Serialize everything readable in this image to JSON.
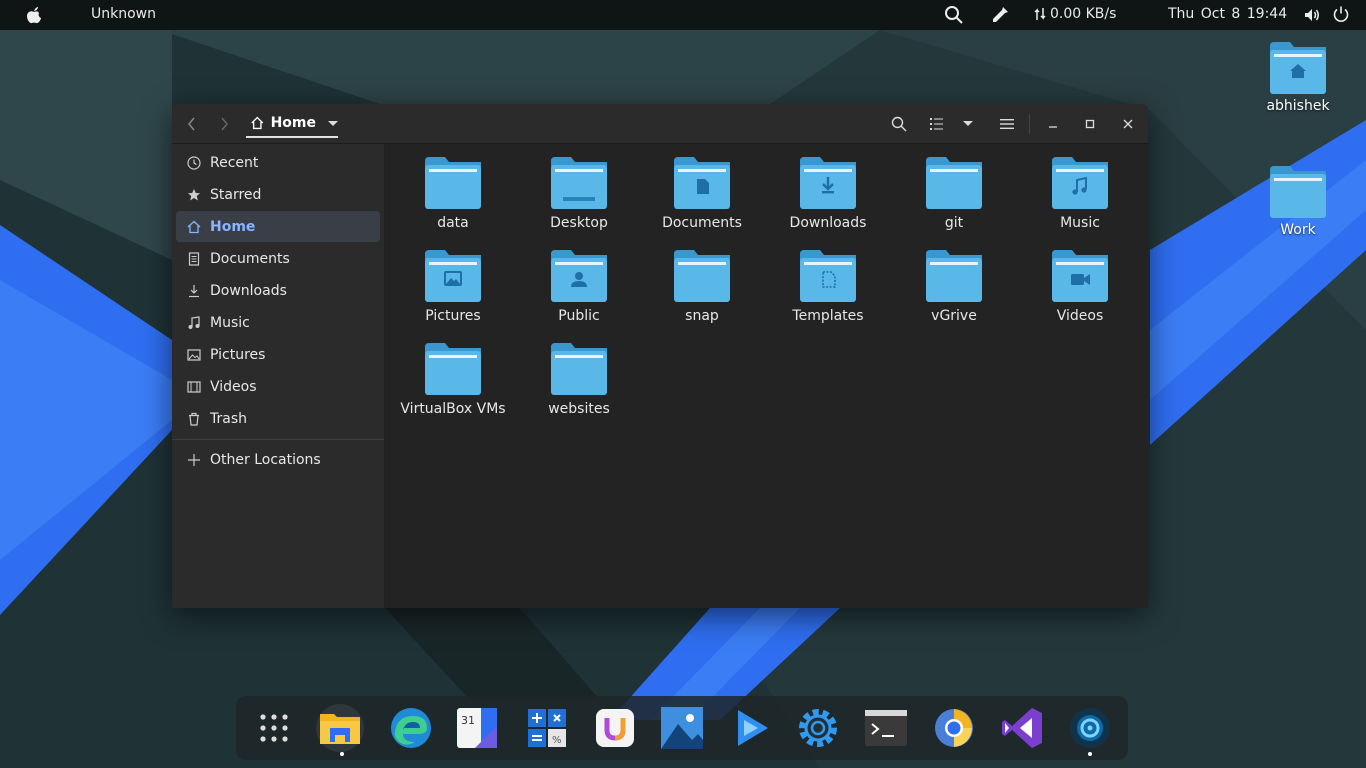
{
  "topbar": {
    "app_name": "Unknown",
    "network": "0.00 KB/s",
    "clock": "Thu Oct 8  19:44",
    "icons": [
      "apple-icon",
      "search-icon",
      "color-picker-icon",
      "network-arrows-icon",
      "volume-icon",
      "power-icon"
    ]
  },
  "desktop": {
    "icons": [
      {
        "label": "abhishek",
        "icon": "home-folder-icon"
      },
      {
        "label": "Work",
        "icon": "folder-icon"
      }
    ]
  },
  "window": {
    "path_label": "Home",
    "sidebar": [
      {
        "label": "Recent",
        "icon": "clock-icon"
      },
      {
        "label": "Starred",
        "icon": "star-icon"
      },
      {
        "label": "Home",
        "icon": "home-icon",
        "active": true
      },
      {
        "label": "Documents",
        "icon": "document-icon"
      },
      {
        "label": "Downloads",
        "icon": "download-icon"
      },
      {
        "label": "Music",
        "icon": "music-icon"
      },
      {
        "label": "Pictures",
        "icon": "picture-icon"
      },
      {
        "label": "Videos",
        "icon": "video-icon"
      },
      {
        "label": "Trash",
        "icon": "trash-icon"
      }
    ],
    "other_locations": "Other Locations",
    "folders": [
      {
        "label": "data",
        "emblem": "none"
      },
      {
        "label": "Desktop",
        "emblem": "desktop"
      },
      {
        "label": "Documents",
        "emblem": "document"
      },
      {
        "label": "Downloads",
        "emblem": "download"
      },
      {
        "label": "git",
        "emblem": "none"
      },
      {
        "label": "Music",
        "emblem": "music"
      },
      {
        "label": "Pictures",
        "emblem": "picture"
      },
      {
        "label": "Public",
        "emblem": "person"
      },
      {
        "label": "snap",
        "emblem": "none"
      },
      {
        "label": "Templates",
        "emblem": "template"
      },
      {
        "label": "vGrive",
        "emblem": "none"
      },
      {
        "label": "Videos",
        "emblem": "video"
      },
      {
        "label": "VirtualBox VMs",
        "emblem": "none"
      },
      {
        "label": "websites",
        "emblem": "none"
      }
    ]
  },
  "dock": {
    "apps": [
      "app-grid-icon",
      "files-app-icon",
      "edge-browser-icon",
      "calendar-app-icon",
      "calculator-app-icon",
      "ulauncher-app-icon",
      "image-viewer-app-icon",
      "video-player-app-icon",
      "settings-app-icon",
      "terminal-app-icon",
      "chromium-app-icon",
      "visual-studio-app-icon",
      "dock-app-icon"
    ],
    "calendar_day": "31"
  },
  "colors": {
    "folder_blue": "#5ab8e8",
    "folder_dark": "#3a98d0",
    "accent": "#8ab4ff",
    "stripe_blue": "#2f6ef0"
  }
}
